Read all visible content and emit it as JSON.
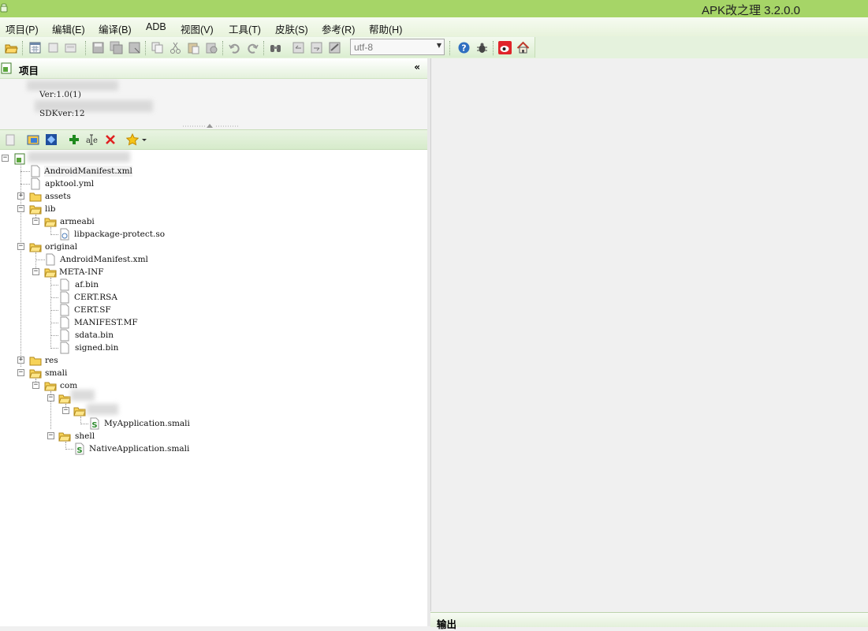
{
  "window": {
    "title": "APK改之理 3.2.0.0",
    "accent_color": "#a6d567"
  },
  "menubar": {
    "items": [
      {
        "label": "项目(P)"
      },
      {
        "label": "编辑(E)"
      },
      {
        "label": "编译(B)"
      },
      {
        "label": "ADB"
      },
      {
        "label": "视图(V)"
      },
      {
        "label": "工具(T)"
      },
      {
        "label": "皮肤(S)"
      },
      {
        "label": "参考(R)"
      },
      {
        "label": "帮助(H)"
      }
    ]
  },
  "toolbar": {
    "encoding_value": "utf-8",
    "icons": [
      "open-folder-icon",
      "calendar-icon",
      "window-icon",
      "window-icon",
      "save-icon",
      "save-all-icon",
      "save-as-icon",
      "copy-icon",
      "cut-icon",
      "paste-icon",
      "paste-special-icon",
      "undo-icon",
      "redo-icon",
      "binoculars-icon",
      "find-prev-icon",
      "find-next-icon",
      "replace-icon",
      "help-icon",
      "bug-icon",
      "weibo-icon",
      "home-icon"
    ]
  },
  "project_panel": {
    "title": "项目",
    "collapse_symbol": "«",
    "version_text": "Ver:1.0(1)",
    "sdk_text": "SDKver:12"
  },
  "tree_toolbar": {
    "icons": [
      "page-icon",
      "folder-open-icon",
      "refresh-icon",
      "add-icon",
      "rename-icon",
      "delete-icon",
      "star-icon",
      "dropdown-arrow-icon"
    ]
  },
  "tree": {
    "nodes": [
      {
        "label": "AndroidManifest.xml",
        "type": "file"
      },
      {
        "label": "apktool.yml",
        "type": "file"
      },
      {
        "label": "assets",
        "type": "folder",
        "expanded": false
      },
      {
        "label": "lib",
        "type": "folder",
        "expanded": true
      },
      {
        "label": "armeabi",
        "type": "folder",
        "expanded": true
      },
      {
        "label": "libpackage-protect.so",
        "type": "so"
      },
      {
        "label": "original",
        "type": "folder",
        "expanded": true
      },
      {
        "label": "AndroidManifest.xml",
        "type": "file"
      },
      {
        "label": "META-INF",
        "type": "folder",
        "expanded": true
      },
      {
        "label": "af.bin",
        "type": "file"
      },
      {
        "label": "CERT.RSA",
        "type": "file"
      },
      {
        "label": "CERT.SF",
        "type": "file"
      },
      {
        "label": "MANIFEST.MF",
        "type": "file"
      },
      {
        "label": "sdata.bin",
        "type": "file"
      },
      {
        "label": "signed.bin",
        "type": "file"
      },
      {
        "label": "res",
        "type": "folder",
        "expanded": false
      },
      {
        "label": "smali",
        "type": "folder",
        "expanded": true
      },
      {
        "label": "com",
        "type": "folder",
        "expanded": true
      },
      {
        "label": "MyApplication.smali",
        "type": "smali"
      },
      {
        "label": "shell",
        "type": "folder",
        "expanded": true
      },
      {
        "label": "NativeApplication.smali",
        "type": "smali"
      }
    ]
  },
  "output_panel": {
    "title": "输出"
  }
}
